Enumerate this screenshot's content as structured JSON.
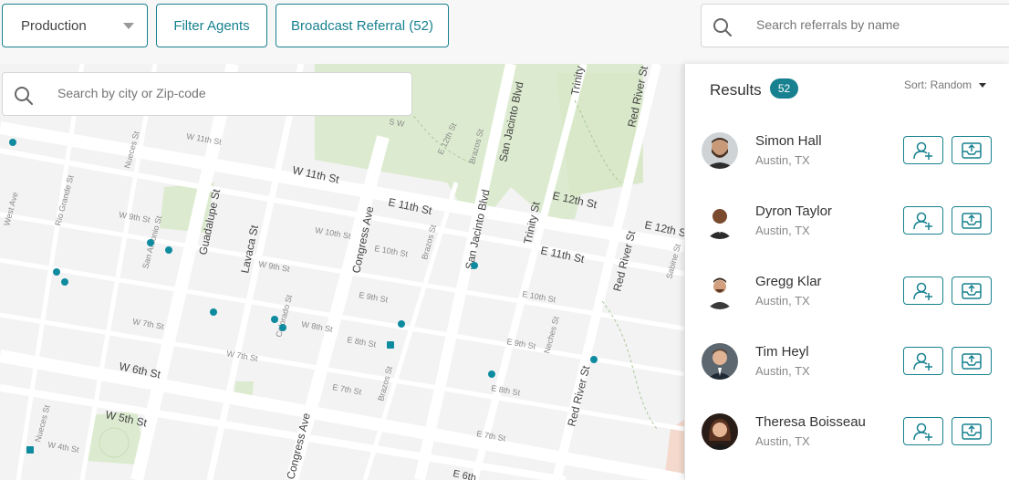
{
  "toolbar": {
    "production_select": "Production",
    "filter_label": "Filter Agents",
    "broadcast_label": "Broadcast Referral (52)",
    "search_placeholder": "Search referrals by name"
  },
  "map": {
    "search_placeholder": "Search by city or Zip-code",
    "streets": {
      "guadalupe": "Guadalupe St",
      "lavaca": "Lavaca St",
      "congress_top": "Congress Ave",
      "congress_bottom": "Congress Ave",
      "san_jacinto_top": "San Jacinto Blvd",
      "san_jacinto_mid": "San Jacinto Blvd",
      "trinity_top": "Trinity",
      "trinity_mid": "Trinity St",
      "red_river_top": "Red River St",
      "red_river_mid": "Red River St",
      "red_river_bottom": "Red River St",
      "w11th_major": "W 11th St",
      "e11th_major": "E 11th St",
      "e11th_major_2": "E 11th St",
      "e12th_major": "E 12th St",
      "e12th_major_2": "E 12th St",
      "w6th_major": "W 6th St",
      "w5th_major": "W 5th St",
      "w11th_minor": "W 11th St",
      "nueces_top": "Nueces St",
      "west_ave": "West Ave",
      "rio_grande": "Rio Grande St",
      "w9th": "W 9th St",
      "w9th_2": "W 9th St",
      "san_antonio": "San Antonio St",
      "w10th": "W 10th St",
      "e10th": "E 10th St",
      "brazos_top": "Brazos St",
      "brazos_mid": "Brazos St",
      "brazos_low": "Brazos St",
      "w7th": "W 7th St",
      "w7th_2": "W 7th St",
      "colorado": "Colorado St",
      "w8th": "W 8th St",
      "e9th": "E 9th St",
      "e8th": "E 8th St",
      "e7th": "E 7th St",
      "e10th_right": "E 10th St",
      "e9th_right": "E 9th St",
      "neches": "Neches St",
      "e8th_right": "E 8th St",
      "e7th_right": "E 7th St",
      "e6th": "E 6th",
      "sabine": "Sabine St",
      "nueces_bottom": "Nueces St",
      "w4th": "W 4th St",
      "e12th_park": "E 12th St",
      "sw_park": "S W",
      "e12_park": "E 12th St"
    },
    "marker_color": "#0f8ba0"
  },
  "results": {
    "title": "Results",
    "count": "52",
    "sort_label": "Sort: Random",
    "accent": "#17818f",
    "agents": [
      {
        "name": "Simon Hall",
        "location": "Austin, TX"
      },
      {
        "name": "Dyron Taylor",
        "location": "Austin, TX"
      },
      {
        "name": "Gregg Klar",
        "location": "Austin, TX"
      },
      {
        "name": "Tim Heyl",
        "location": "Austin, TX"
      },
      {
        "name": "Theresa Boisseau",
        "location": "Austin, TX"
      }
    ]
  }
}
